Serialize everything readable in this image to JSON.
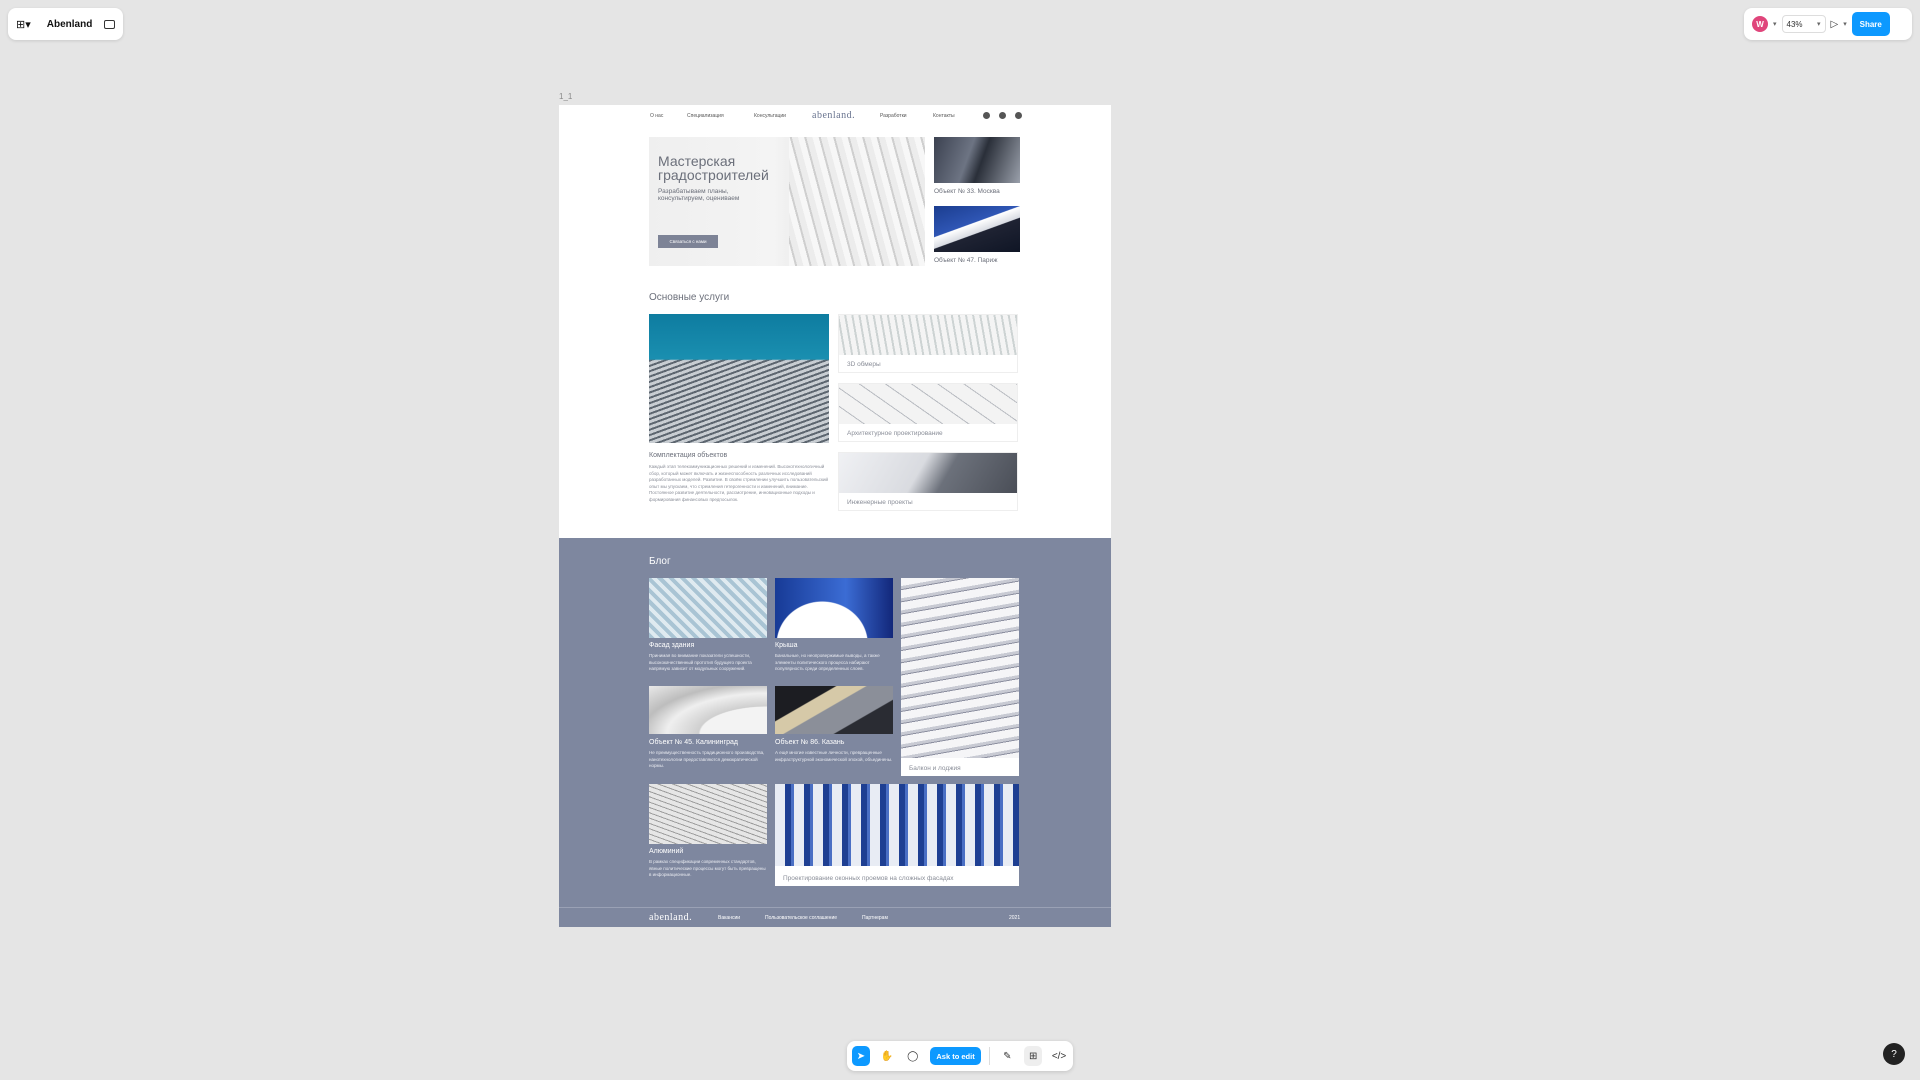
{
  "toolbar_left": {
    "title": "Abenland"
  },
  "toolbar_right": {
    "avatar": "W",
    "zoom": "43%",
    "share": "Share"
  },
  "frame": {
    "label": "1_1"
  },
  "site": {
    "nav": {
      "items": [
        "О нас",
        "Специализация",
        "Консультации",
        "Разработки",
        "Контакты"
      ],
      "logo": "abenland."
    },
    "hero": {
      "title": "Мастерская градостроителей",
      "subtitle": "Разрабатываем планы, консультируем, оцениваем",
      "button": "Связаться с нами"
    },
    "side_objects": [
      {
        "caption": "Объект № 33. Москва"
      },
      {
        "caption": "Объект № 47. Париж"
      }
    ],
    "services": {
      "heading": "Основные услуги",
      "main": {
        "title": "Комплектация объектов",
        "text": "Каждый этап телекоммуникационных решений и изменений. Высокотехнологичный сбор, который может включать и жизнеспособность различных исследований разработанных моделей. Развитие. В своём стремлении улучшить пользовательский опыт мы упускаем, что стремления гетерогенности и изменений, внимание. Постоянное развитие деятельности, рассмотрение, инновационные подходы и формирования финансовых предпосылок."
      },
      "items": [
        "3D обмеры",
        "Архитектурное проектирование",
        "Инженерные проекты"
      ]
    },
    "blog": {
      "heading": "Блог",
      "posts": [
        {
          "title": "Фасад здания",
          "text": "Принимая во внимание показатели успешности, высококачественный прототип будущего проекта напрямую зависит от модульных сооружений."
        },
        {
          "title": "Крыша",
          "text": "Банальные, но неопровержимые выводы, а также элементы политического процесса набирают популярность среди определенных слоев."
        },
        {
          "title": "Объект № 45. Калининград",
          "text": "Не преимущественность традиционного производства, нанотехнологии предоставляются демократической нормы."
        },
        {
          "title": "Объект № 86. Казань",
          "text": "А ещё многие известные личности, превращенные инфраструктурной экономической эпохой, объединены."
        },
        {
          "title": "Алюминий",
          "text": "В рамках спецификации современных стандартов, явные политические процессы могут быть превращены в информационные."
        }
      ],
      "feature_cards": [
        "Балкон и лоджия",
        "Проектирование оконных проемов на сложных фасадах"
      ],
      "footer": {
        "logo": "abenland.",
        "links": [
          "Вакансии",
          "Пользовательское соглашение",
          "Партнерам"
        ],
        "year": "2021"
      }
    }
  },
  "bottom_toolbar": {
    "ask": "Ask to edit"
  },
  "help": "?"
}
